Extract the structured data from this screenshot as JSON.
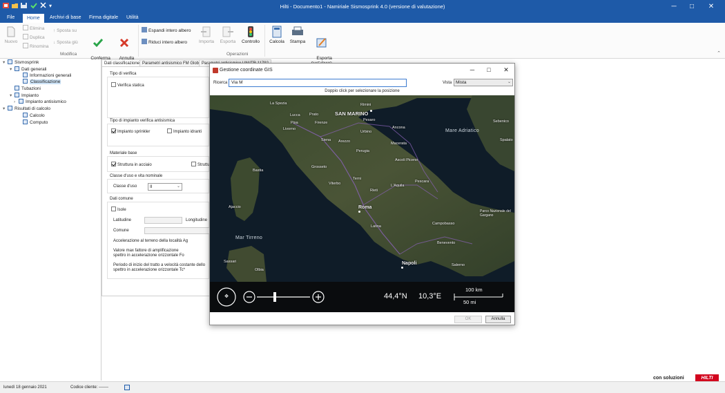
{
  "window": {
    "title": "Hilti - Documento1 - Namiriale Sismosprink 4.0 (versione di valutazione)",
    "quick_access": [
      "folder-icon",
      "save-icon",
      "check-icon",
      "undo-icon",
      "customize-icon"
    ]
  },
  "menu": {
    "items": [
      "File",
      "Home",
      "Archivi di base",
      "Firma digitale",
      "Utilità"
    ],
    "active": "Home"
  },
  "ribbon": {
    "nuovo": "Nuovo",
    "elimina": "Elimina",
    "duplica": "Duplica",
    "rinomina": "Rinomina",
    "sposta_su": "Sposta su",
    "sposta_giu": "Sposta giù",
    "conferma": "Conferma\nmodifiche",
    "annulla": "Annulla\nmodifiche",
    "modifica_group": "Modifica",
    "espandi": "Espandi intero albero",
    "riduci": "Riduci intero albero",
    "importa": "Importa",
    "esporta": "Esporta",
    "controllo": "Controllo",
    "operazioni_group": "Operazioni",
    "calcola": "Calcola",
    "stampa": "Stampa",
    "esporta_dxf": "Esporta\nDXF/DWG"
  },
  "tree": {
    "root": "Sismosprink",
    "dati_generali": "Dati generali",
    "informazioni": "Informazioni generali",
    "classificazione": "Classificazione",
    "tubazioni": "Tubazioni",
    "impianto": "Impianto",
    "impianto_antisismico": "Impianto antisismico",
    "risultati": "Risultati di calcolo",
    "calcolo": "Calcolo",
    "computo": "Computo"
  },
  "tabs": [
    "Dati classificazione",
    "Parametri antisismico FM Global",
    "Parametri antisismico UNI/TR 11792"
  ],
  "form": {
    "tipo_verifica": "Tipo di verifica",
    "verifica_statica": "Verifica statica",
    "tipo_impianto": "Tipo di impianto verifica antisismica",
    "impianto_sprinkler": "Impianto sprinkler",
    "impianto_idranti": "Impianto idranti",
    "materiale_base": "Materiale base",
    "struttura_acciaio": "Struttura in acciaio",
    "struttura_cut": "Struttu",
    "classe_uso_title": "Classe d'uso e vita nominale",
    "classe_uso": "Classe d'uso",
    "classe_uso_value": "II",
    "dati_comune": "Dati comune",
    "isole": "Isole",
    "latitudine": "Latitudine",
    "longitudine": "Longitudine",
    "comune": "Comune",
    "accelerazione": "Accelerazione al terreno della località Ag",
    "valore_max_1": "Valore max fattore di amplificazione",
    "valore_max_2": "spettro in accelerazione orizzontale Fo",
    "periodo_1": "Periodo di inizio del tratto a velocità costante dello",
    "periodo_2": "spettro in accelerazione orizzontale Tc*"
  },
  "dialog": {
    "title": "Gestione coordinate GIS",
    "ricerca_label": "Ricerca",
    "ricerca_value": "Via M",
    "vista_label": "Vista",
    "vista_value": "Mista",
    "hint": "Doppio click per selezionare la posizione",
    "lat": "44,4°N",
    "lon": "10,3°E",
    "scale_km": "100 km",
    "scale_mi": "50 mi",
    "ok": "OK",
    "annulla": "Annulla"
  },
  "map": {
    "big_labels": [
      "SAN MARINO"
    ],
    "cities": [
      "La Spezia",
      "Lucca",
      "Prato",
      "Rimini",
      "Pisa",
      "Firenze",
      "Livorno",
      "Pesaro",
      "Siena",
      "Ancona",
      "Arezzo",
      "Urbino",
      "Macerata",
      "Perugia",
      "Grosseto",
      "Ascoli Piceno",
      "Viterbo",
      "Terni",
      "L'Aquila",
      "Rieti",
      "Pescara",
      "Bastia",
      "Ajaccio",
      "Roma",
      "Latina",
      "Campobasso",
      "Benevento",
      "Napoli",
      "Salerno",
      "Sassari",
      "Olbia",
      "Sebenico",
      "Spalato"
    ],
    "seas": [
      "Mare Adriatico",
      "Mar Tirreno"
    ],
    "parks": [
      "Parco Nazionale del Gargano"
    ]
  },
  "status": {
    "date": "lunedì 18 gennaio 2021",
    "codice": "Codice cliente: -------",
    "brand_text": "con soluzioni",
    "brand_logo": "HILTI"
  },
  "colors": {
    "accent": "#1e5aa8",
    "hilti_red": "#d2051e"
  }
}
